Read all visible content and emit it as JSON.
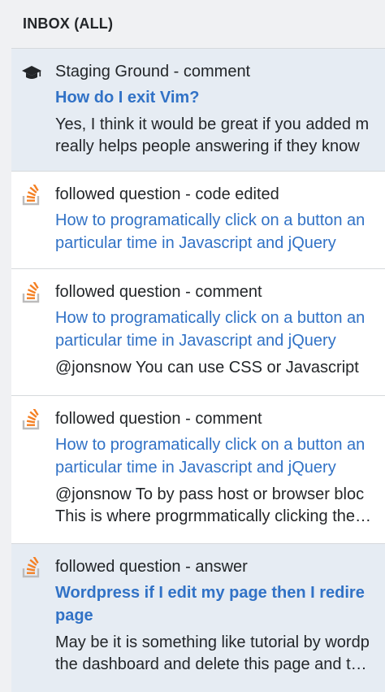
{
  "inbox": {
    "header": "INBOX (ALL)",
    "items": [
      {
        "icon": "graduation-cap-icon",
        "type": "Staging Ground - comment",
        "title_lines": [
          "How do I exit Vim?"
        ],
        "body_lines": [
          "Yes, I think it would be great if you added m",
          "really helps people answering if they know"
        ]
      },
      {
        "icon": "stack-overflow-icon",
        "type": "followed question - code edited",
        "title_lines": [
          "How to programatically click on a button an",
          "particular time in Javascript and jQuery"
        ],
        "body_lines": []
      },
      {
        "icon": "stack-overflow-icon",
        "type": "followed question - comment",
        "title_lines": [
          "How to programatically click on a button an",
          "particular time in Javascript and jQuery"
        ],
        "body_lines": [
          "@jonsnow You can use CSS or Javascript"
        ]
      },
      {
        "icon": "stack-overflow-icon",
        "type": "followed question - comment",
        "title_lines": [
          "How to programatically click on a button an",
          "particular time in Javascript and jQuery"
        ],
        "body_lines": [
          "@jonsnow To by pass host or browser bloc",
          "This is where progrmmatically clicking the…"
        ]
      },
      {
        "icon": "stack-overflow-icon",
        "type": "followed question - answer",
        "title_lines": [
          "Wordpress if I edit my page then I redire",
          "page"
        ],
        "body_lines": [
          "May be it is something like tutorial by wordp",
          "the dashboard and delete this page and t…"
        ]
      }
    ]
  },
  "colors": {
    "link": "#3172c6",
    "unread_bg": "#e6ecf3",
    "so_orange": "#f48024",
    "so_gray": "#bcbbbb"
  }
}
